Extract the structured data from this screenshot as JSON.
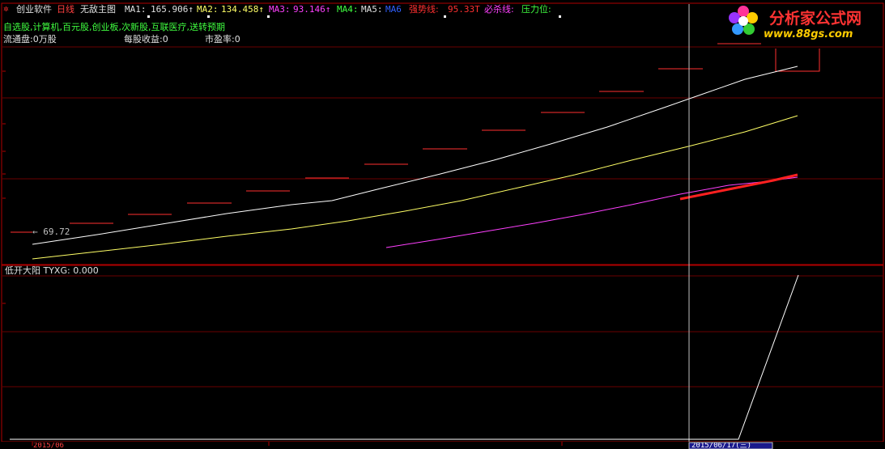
{
  "header": {
    "app_name": "创业软件",
    "period": "日线",
    "indicator_name": "无敌主图",
    "ma1_label": "MA1:",
    "ma1_value": "165.906↑",
    "ma2_label": "MA2:",
    "ma2_value": "134.458↑",
    "ma3_label": "MA3:",
    "ma3_value": "93.146↑",
    "ma4_label": "MA4:",
    "ma5_label": "MA5:",
    "ma5_value": "MA6",
    "strong_label": "强势线:",
    "strong_value": "95.33T",
    "must_label": "必杀线:",
    "pressure_label": "压力位:"
  },
  "info": {
    "blocks": "自选股,计算机,百元股,创业板,次新股,互联医疗,送转预期",
    "float_shares": "流通盘:0万股",
    "eps": "每股收益:0",
    "pe": "市盈率:0"
  },
  "price_marker": "← 69.72",
  "sub_panel": {
    "title": "低开大阳 TYXG: 0.000"
  },
  "footer": {
    "left_date": "2015/06",
    "cursor_date": "2015/06/17(三)"
  },
  "watermark": {
    "name": "分析家公式网",
    "url": "www.88gs.com"
  },
  "colors": {
    "grid": "#7a0000",
    "border": "#b00000",
    "ma_white": "#ffffff",
    "ma_yellow": "#ffff66",
    "ma_magenta": "#ff40ff",
    "strong_red": "#ff2020",
    "steps": "#ff3030",
    "cursor": "#bfbfbf",
    "info_green": "#40ff40"
  }
}
